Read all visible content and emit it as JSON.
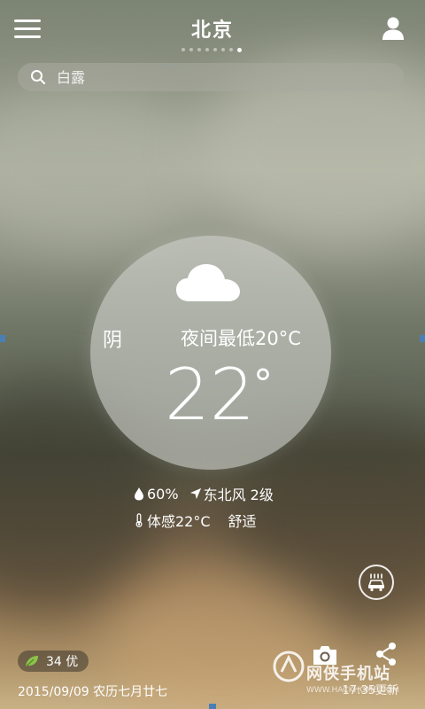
{
  "header": {
    "city": "北京",
    "page_count": 8,
    "active_page": 7
  },
  "search": {
    "placeholder": "白露"
  },
  "weather": {
    "condition": "阴",
    "night_low": "夜间最低20°C",
    "temperature": "22",
    "degree_symbol": "°",
    "humidity": "60%",
    "wind": "东北风 2级",
    "feels_like": "体感22°C",
    "comfort": "舒适"
  },
  "footer": {
    "aqi": "34 优",
    "date": "2015/09/09 农历七月廿七",
    "updated": "17:35更新"
  },
  "watermark": {
    "name": "网侠手机站",
    "url": "WWW.HACKHOME.COM"
  },
  "colors": {
    "text": "#ffffff",
    "leaf": "#8bc34a",
    "circle": "rgba(210,212,206,0.62)"
  },
  "icons": {
    "menu": "menu-icon",
    "user": "user-icon",
    "search": "search-icon",
    "weather": "cloud-icon",
    "humidity": "water-drop-icon",
    "wind": "wind-direction-icon",
    "thermometer": "thermometer-icon",
    "car": "car-wash-icon",
    "leaf": "leaf-icon",
    "camera": "camera-icon",
    "share": "share-icon"
  }
}
